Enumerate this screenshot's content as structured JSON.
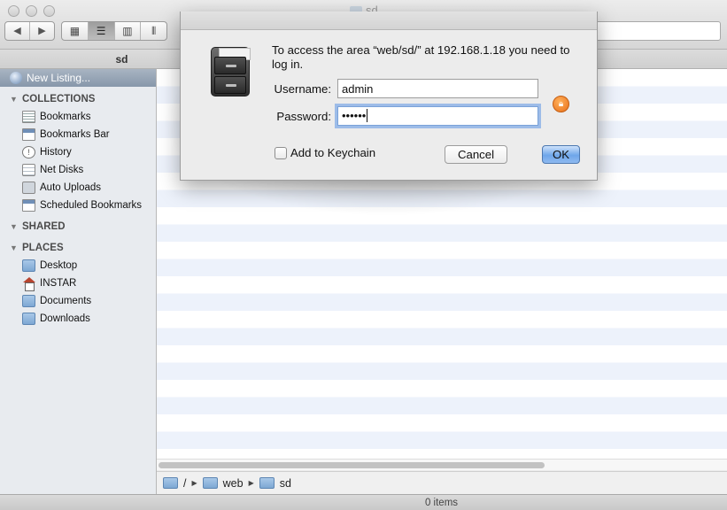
{
  "window": {
    "title": "sd",
    "tab_label": "sd"
  },
  "toolbar": {
    "back_icon": "◀",
    "forward_icon": "▶",
    "view_icons": [
      "icon-view",
      "list-view",
      "column-view",
      "cover-flow-view"
    ]
  },
  "sidebar": {
    "new_listing": "New Listing...",
    "collections_title": "COLLECTIONS",
    "collections": [
      {
        "label": "Bookmarks",
        "icon": "bookmarks-icon"
      },
      {
        "label": "Bookmarks Bar",
        "icon": "bookmarks-bar-icon"
      },
      {
        "label": "History",
        "icon": "history-icon"
      },
      {
        "label": "Net Disks",
        "icon": "net-disks-icon"
      },
      {
        "label": "Auto Uploads",
        "icon": "auto-uploads-icon"
      },
      {
        "label": "Scheduled Bookmarks",
        "icon": "scheduled-bookmarks-icon"
      }
    ],
    "shared_title": "SHARED",
    "places_title": "PLACES",
    "places": [
      {
        "label": "Desktop",
        "icon": "folder-icon"
      },
      {
        "label": "INSTAR",
        "icon": "home-icon"
      },
      {
        "label": "Documents",
        "icon": "folder-icon"
      },
      {
        "label": "Downloads",
        "icon": "folder-icon"
      }
    ]
  },
  "path_bar": {
    "segments": [
      "/",
      "web",
      "sd"
    ]
  },
  "status": {
    "items_count": "0 items"
  },
  "dialog": {
    "message": "To access the area “web/sd/” at 192.168.1.18 you need to log in.",
    "username_label": "Username:",
    "username_value": "admin",
    "password_label": "Password:",
    "password_value": "••••••",
    "keychain_label": "Add to Keychain",
    "cancel_label": "Cancel",
    "ok_label": "OK"
  },
  "colors": {
    "default_button": "#6ea6ea",
    "stripe": "#edf2fb",
    "lock_badge": "#e8701a"
  }
}
